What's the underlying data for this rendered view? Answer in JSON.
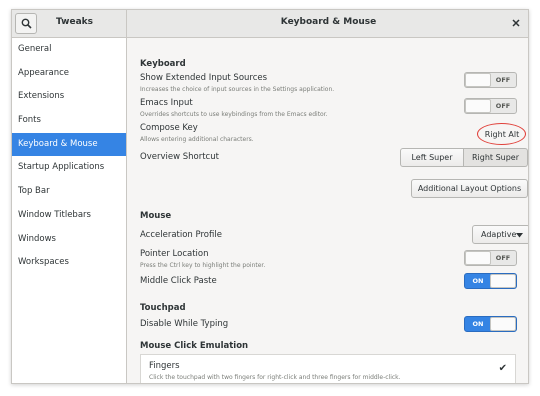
{
  "app": {
    "title": "Tweaks",
    "page_title": "Keyboard & Mouse"
  },
  "sidebar": {
    "items": [
      {
        "label": "General",
        "active": false
      },
      {
        "label": "Appearance",
        "active": false
      },
      {
        "label": "Extensions",
        "active": false
      },
      {
        "label": "Fonts",
        "active": false
      },
      {
        "label": "Keyboard & Mouse",
        "active": true
      },
      {
        "label": "Startup Applications",
        "active": false
      },
      {
        "label": "Top Bar",
        "active": false
      },
      {
        "label": "Window Titlebars",
        "active": false
      },
      {
        "label": "Windows",
        "active": false
      },
      {
        "label": "Workspaces",
        "active": false
      }
    ]
  },
  "keyboard": {
    "heading": "Keyboard",
    "extended_sources": {
      "label": "Show Extended Input Sources",
      "desc": "Increases the choice of input sources in the Settings application.",
      "state": "OFF"
    },
    "emacs": {
      "label": "Emacs Input",
      "desc": "Overrides shortcuts to use keybindings from the Emacs editor.",
      "state": "OFF"
    },
    "compose": {
      "label": "Compose Key",
      "desc": "Allows entering additional characters.",
      "value": "Right Alt"
    },
    "overview": {
      "label": "Overview Shortcut",
      "option_left": "Left Super",
      "option_right": "Right Super"
    },
    "layout_options_label": "Additional Layout Options"
  },
  "mouse": {
    "heading": "Mouse",
    "accel": {
      "label": "Acceleration Profile",
      "value": "Adaptive"
    },
    "pointer": {
      "label": "Pointer Location",
      "desc": "Press the Ctrl key to highlight the pointer.",
      "state": "OFF"
    },
    "middle": {
      "label": "Middle Click Paste",
      "state": "ON"
    }
  },
  "touchpad": {
    "heading": "Touchpad",
    "dwt": {
      "label": "Disable While Typing",
      "state": "ON"
    }
  },
  "emulation": {
    "heading": "Mouse Click Emulation",
    "fingers": {
      "label": "Fingers",
      "desc": "Click the touchpad with two fingers for right-click and three fingers for middle-click.",
      "checked_icon": "checkmark"
    }
  },
  "colors": {
    "accent": "#3584e4",
    "annotation": "#e0403a"
  }
}
